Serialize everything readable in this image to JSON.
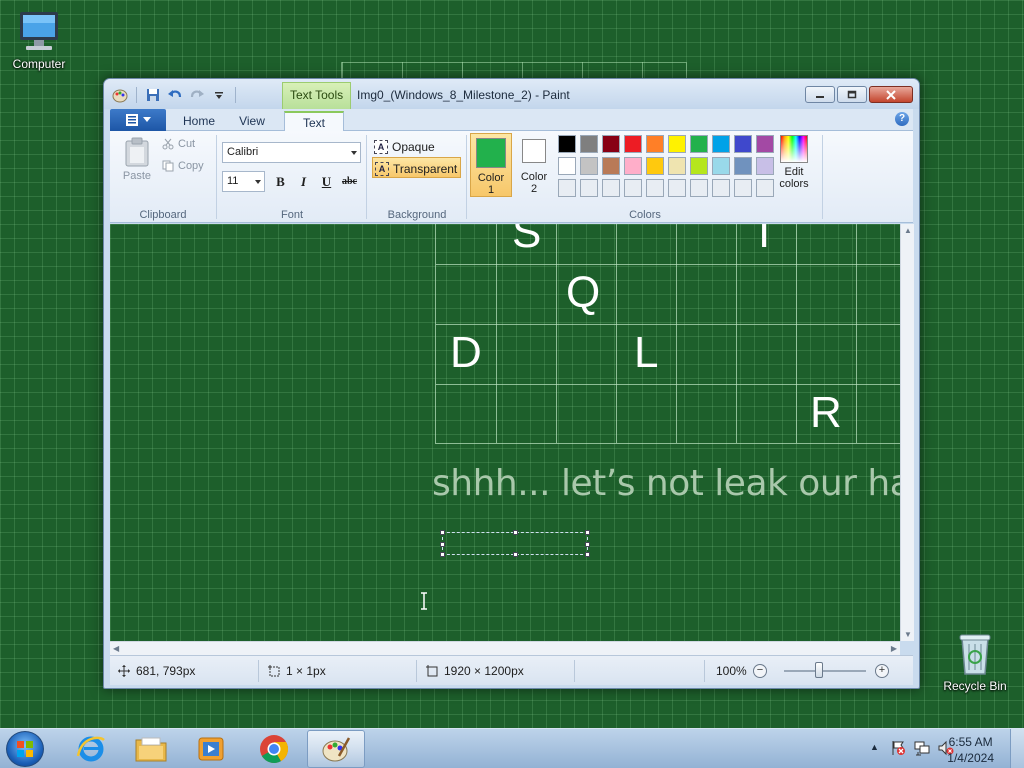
{
  "desktop": {
    "icons": [
      {
        "label": "Computer"
      },
      {
        "label": "Recycle Bin"
      }
    ]
  },
  "window": {
    "title": "Img0_(Windows_8_Milestone_2) - Paint",
    "contextual_tab": "Text Tools",
    "buttons": {
      "minimize": "minimize",
      "maximize": "maximize",
      "close": "close"
    }
  },
  "ribbon": {
    "tabs": [
      "Home",
      "View",
      "Text"
    ],
    "active_tab": "Text",
    "clipboard": {
      "paste": "Paste",
      "cut": "Cut",
      "copy": "Copy",
      "label": "Clipboard"
    },
    "font": {
      "family": "Calibri",
      "size": "11",
      "bold": "B",
      "italic": "I",
      "underline": "U",
      "strike": "abc",
      "label": "Font"
    },
    "background": {
      "opaque": "Opaque",
      "transparent": "Transparent",
      "selected": "Transparent",
      "label": "Background"
    },
    "colors": {
      "color1_label": "Color 1",
      "color2_label": "Color 2",
      "color1_value": "#22b14c",
      "color2_value": "#ffffff",
      "edit_label": "Edit colors",
      "label": "Colors",
      "palette_row1": [
        "#000000",
        "#7f7f7f",
        "#880015",
        "#ed1c24",
        "#ff7f27",
        "#fff200",
        "#22b14c",
        "#00a2e8",
        "#3f48cc",
        "#a349a4"
      ],
      "palette_row2": [
        "#ffffff",
        "#c3c3c3",
        "#b97a57",
        "#ffaec9",
        "#ffc90e",
        "#efe4b0",
        "#b5e61d",
        "#99d9ea",
        "#7092be",
        "#c8bfe7"
      ],
      "palette_row3": [
        "#e8edf3",
        "#e8edf3",
        "#e8edf3",
        "#e8edf3",
        "#e8edf3",
        "#e8edf3",
        "#e8edf3",
        "#e8edf3",
        "#e8edf3",
        "#e8edf3"
      ]
    }
  },
  "canvas": {
    "letters": [
      "S",
      "I",
      "Q",
      "D",
      "L",
      "R"
    ],
    "caption": "shhh... let’s not leak our hard"
  },
  "statusbar": {
    "cursor_pos": "681, 793px",
    "selection_size": "1 × 1px",
    "image_size": "1920 × 1200px",
    "zoom": "100%",
    "zoom_out": "−",
    "zoom_in": "+"
  },
  "taskbar": {
    "apps": [
      "internet-explorer",
      "file-explorer",
      "media-player",
      "chrome",
      "paint"
    ],
    "time": "6:55 AM",
    "date": "1/4/2024"
  }
}
